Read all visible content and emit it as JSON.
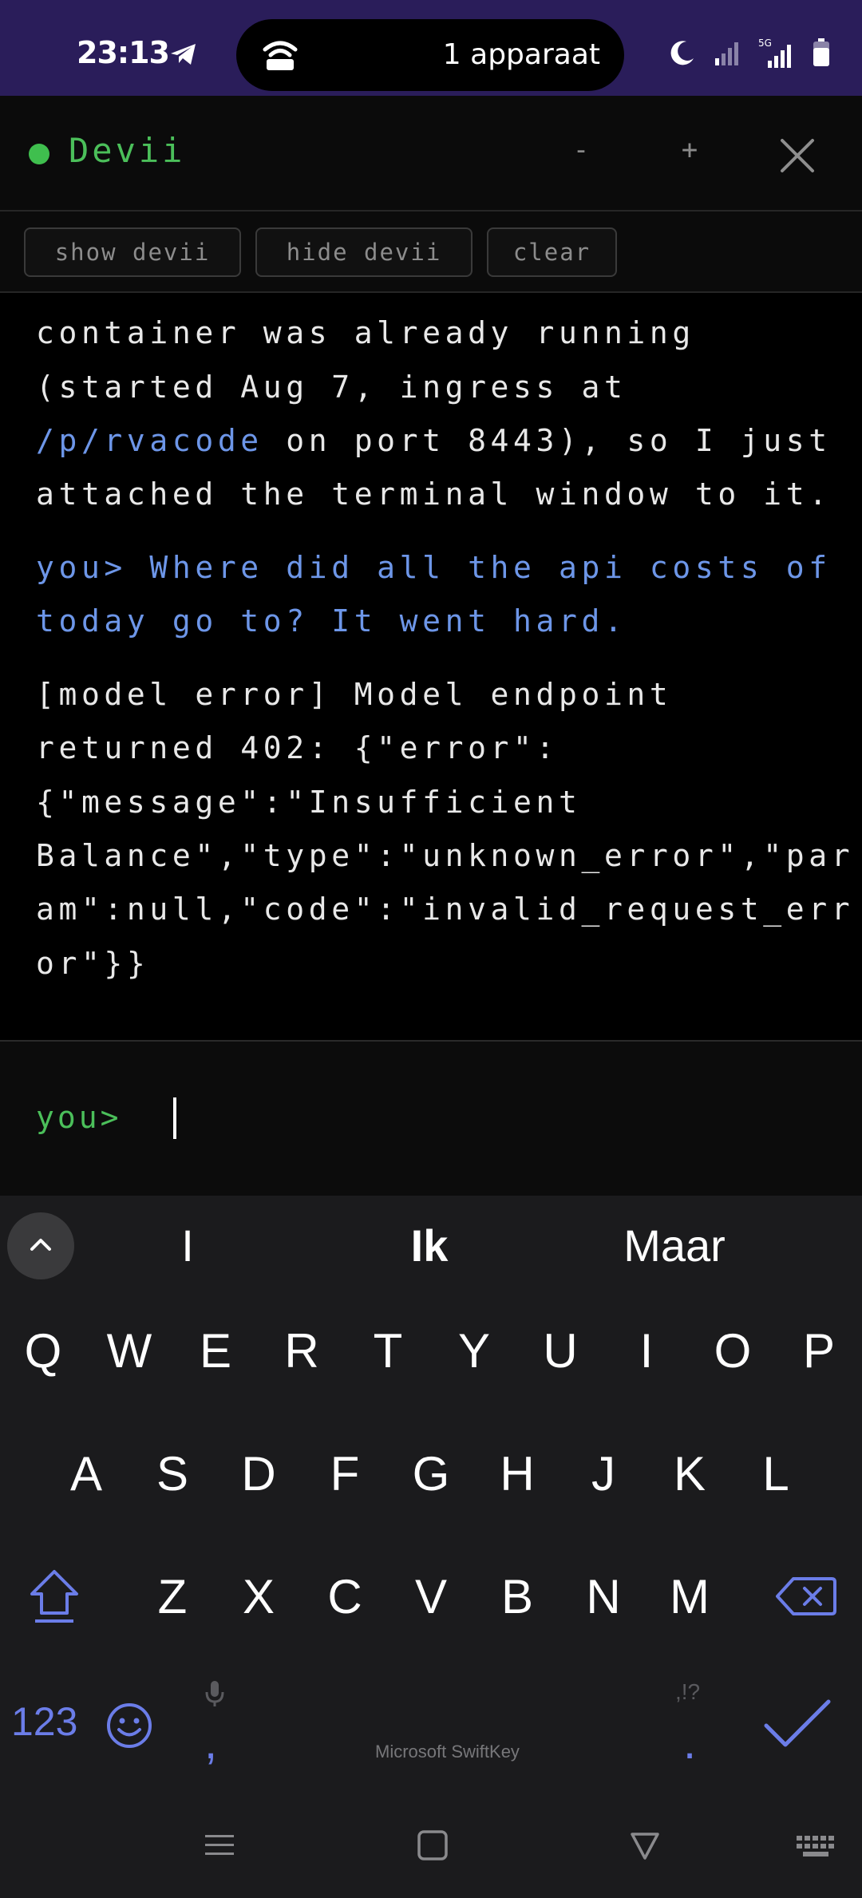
{
  "status_bar": {
    "time": "23:13",
    "hotspot_text": "1 apparaat",
    "icons": [
      "telegram-icon",
      "hotspot-icon",
      "do-not-disturb-icon",
      "signal-icon",
      "5g-signal-icon",
      "battery-icon"
    ]
  },
  "app": {
    "title": "Devii",
    "minimize_label": "-",
    "maximize_label": "+",
    "accent": "#4bbf5a"
  },
  "toolbar": {
    "show_label": "show devii",
    "hide_label": "hide devii",
    "clear_label": "clear"
  },
  "transcript": {
    "msg1_line1": "container was already running",
    "msg1_line2": "(started Aug 7, ingress at",
    "msg1_link": "/p/rvacode",
    "msg1_line3_rest": " on port 8443), so I just",
    "msg1_line4": "attached the terminal window to it.",
    "user_line1": "you> Where did all the api costs of",
    "user_line2": "today go to? It went hard.",
    "err_line1": "[model error] Model endpoint",
    "err_line2": "returned 402: {\"error\":",
    "err_line3": "{\"message\":\"Insufficient",
    "err_line4": "Balance\",\"type\":\"unknown_error\",\"par",
    "err_line5": "am\":null,\"code\":\"invalid_request_err",
    "err_line6": "or\"}}"
  },
  "input": {
    "prompt": "you>",
    "value": ""
  },
  "keyboard": {
    "suggestions": [
      "I",
      "Ik",
      "Maar"
    ],
    "row1": [
      "Q",
      "W",
      "E",
      "R",
      "T",
      "Y",
      "U",
      "I",
      "O",
      "P"
    ],
    "row2": [
      "A",
      "S",
      "D",
      "F",
      "G",
      "H",
      "J",
      "K",
      "L"
    ],
    "row3": [
      "Z",
      "X",
      "C",
      "V",
      "B",
      "N",
      "M"
    ],
    "numbers_label": "123",
    "comma": ",",
    "period": ".",
    "punct_hint": ",!?",
    "brand": "Microsoft SwiftKey",
    "accent": "#6b7de8"
  }
}
